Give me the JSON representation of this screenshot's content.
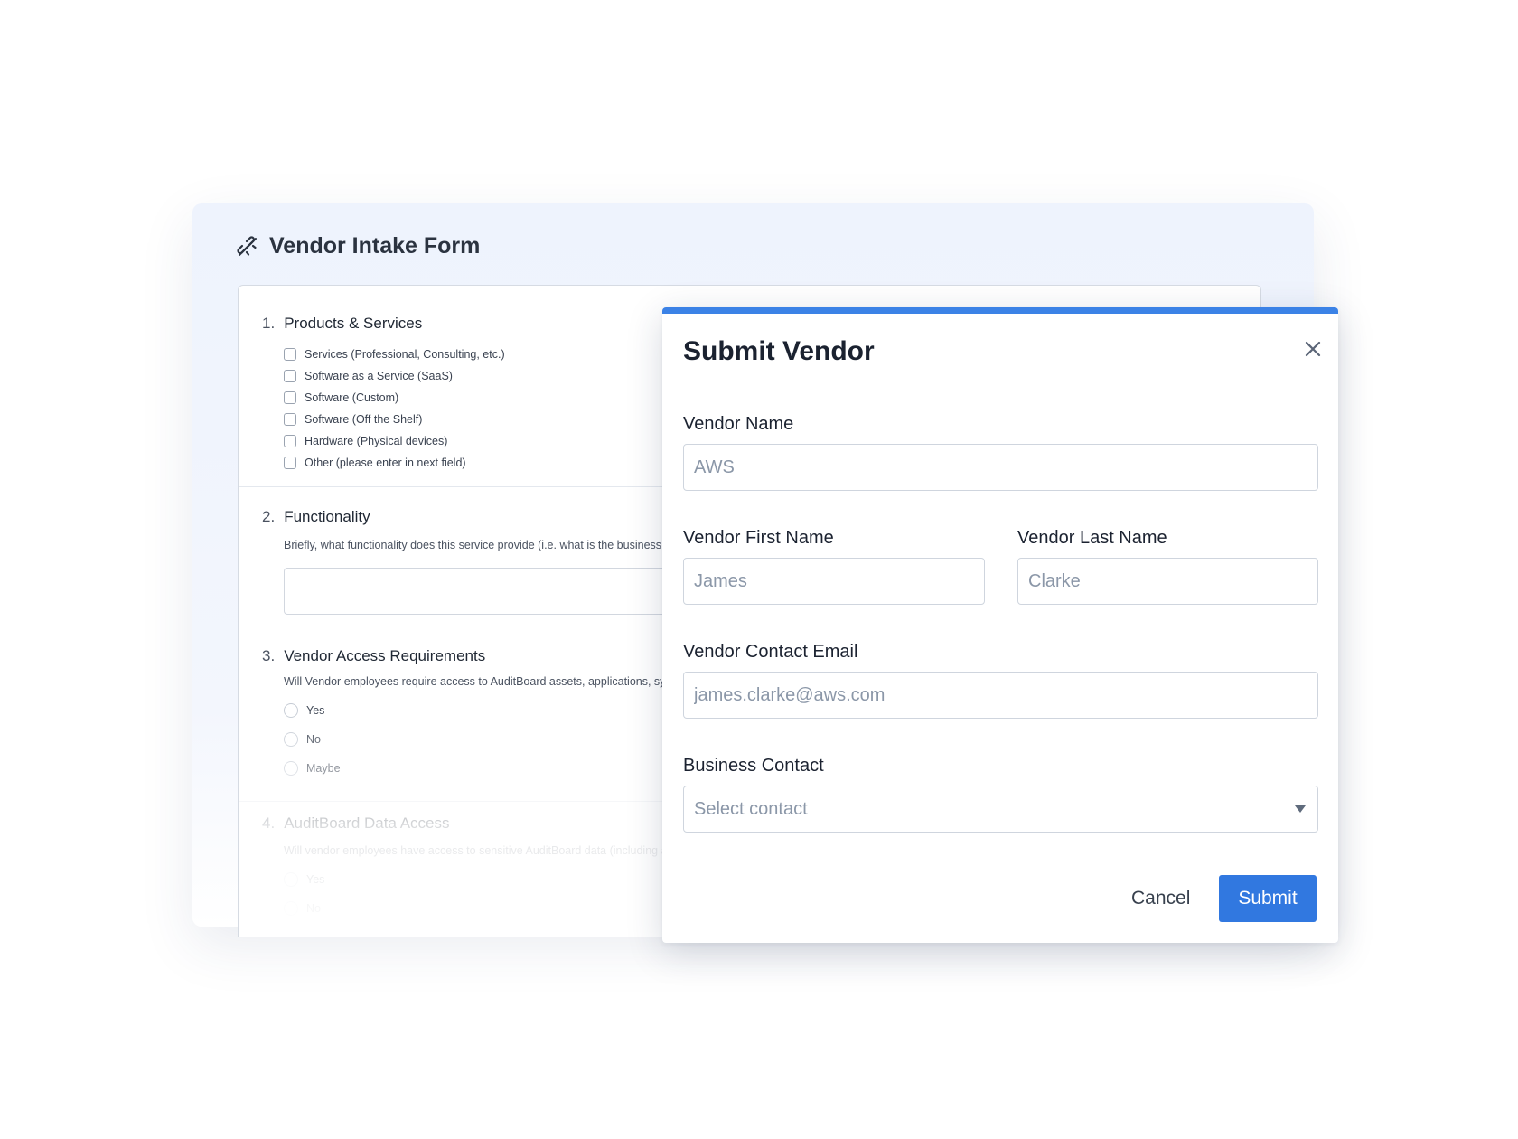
{
  "background_form": {
    "title": "Vendor Intake Form",
    "icon": "link-broken-icon",
    "questions": [
      {
        "number": "1.",
        "title": "Products & Services",
        "options": [
          "Services (Professional, Consulting, etc.)",
          "Software as a Service (SaaS)",
          "Software (Custom)",
          "Software (Off the Shelf)",
          "Hardware (Physical devices)",
          "Other (please enter in next field)"
        ]
      },
      {
        "number": "2.",
        "title": "Functionality",
        "description": "Briefly, what functionality does this service provide (i.e. what is the business"
      },
      {
        "number": "3.",
        "title": "Vendor Access Requirements",
        "description": "Will Vendor employees require access to AuditBoard assets, applications, sy",
        "options": [
          "Yes",
          "No",
          "Maybe"
        ]
      },
      {
        "number": "4.",
        "title": "AuditBoard Data Access",
        "description": "Will vendor employees have access to sensitive AuditBoard data (including a",
        "options": [
          "Yes",
          "No"
        ]
      }
    ]
  },
  "modal": {
    "title": "Submit Vendor",
    "close_icon": "close-icon",
    "accent_color": "#3b82e6",
    "fields": {
      "vendor_name": {
        "label": "Vendor Name",
        "placeholder": "AWS"
      },
      "first_name": {
        "label": "Vendor First Name",
        "placeholder": "James"
      },
      "last_name": {
        "label": "Vendor Last Name",
        "placeholder": "Clarke"
      },
      "email": {
        "label": "Vendor Contact Email",
        "placeholder": "james.clarke@aws.com"
      },
      "business_contact": {
        "label": "Business Contact",
        "selected": "Select contact"
      }
    },
    "cancel_label": "Cancel",
    "submit_label": "Submit",
    "submit_color": "#3178e0"
  }
}
